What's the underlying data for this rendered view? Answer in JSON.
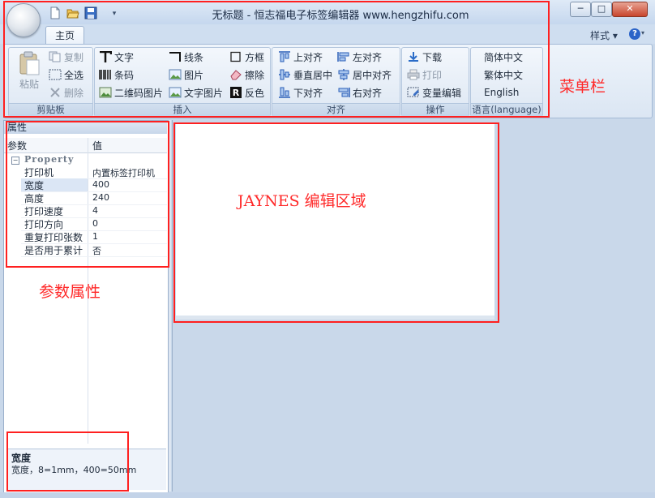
{
  "window": {
    "title": "无标题 - 恒志福电子标签编辑器  www.hengzhifu.com",
    "min_glyph": "─",
    "max_glyph": "□",
    "close_glyph": "✕"
  },
  "quick_access": {
    "icons": [
      "new-file-icon",
      "open-folder-icon",
      "save-icon"
    ],
    "more_glyph": "▾"
  },
  "tabs": {
    "home": "主页",
    "style_menu": "样式 ▾",
    "help_glyph": "?",
    "help_caret": "▾"
  },
  "ribbon": {
    "clipboard": {
      "label": "剪贴板",
      "paste": "粘贴",
      "copy": "复制",
      "select_all": "全选",
      "delete": "删除"
    },
    "insert": {
      "label": "插入",
      "text": "文字",
      "barcode": "条码",
      "qrcode_image": "二维码图片",
      "line": "线条",
      "image": "图片",
      "text_image": "文字图片",
      "frame": "方框",
      "erase": "擦除",
      "invert": "反色"
    },
    "align": {
      "label": "对齐",
      "top": "上对齐",
      "vcenter": "垂直居中",
      "bottom": "下对齐",
      "left": "左对齐",
      "hcenter": "居中对齐",
      "right": "右对齐"
    },
    "ops": {
      "label": "操作",
      "download": "下载",
      "print": "打印",
      "var_edit": "变量编辑"
    },
    "lang": {
      "label": "语言(language)",
      "simplified": "简体中文",
      "traditional": "繁体中文",
      "english": "English"
    }
  },
  "props": {
    "panel_title": "属性",
    "col_param": "参数",
    "col_value": "值",
    "category": "Property",
    "collapse_glyph": "−",
    "rows": [
      {
        "key": "打印机",
        "value": "内置标签打印机"
      },
      {
        "key": "宽度",
        "value": "400"
      },
      {
        "key": "高度",
        "value": "240"
      },
      {
        "key": "打印速度",
        "value": "4"
      },
      {
        "key": "打印方向",
        "value": "0"
      },
      {
        "key": "重复打印张数",
        "value": "1"
      },
      {
        "key": "是否用于累计",
        "value": "否"
      }
    ],
    "help_title": "宽度",
    "help_desc": "宽度，8=1mm，400=50mm"
  },
  "annotations": {
    "menubar": "菜单栏",
    "params": "参数属性",
    "edit_area": "JAYNES 编辑区域"
  },
  "colors": {
    "annotation_red": "#ff2020",
    "window_bg": "#c9d8ea"
  }
}
